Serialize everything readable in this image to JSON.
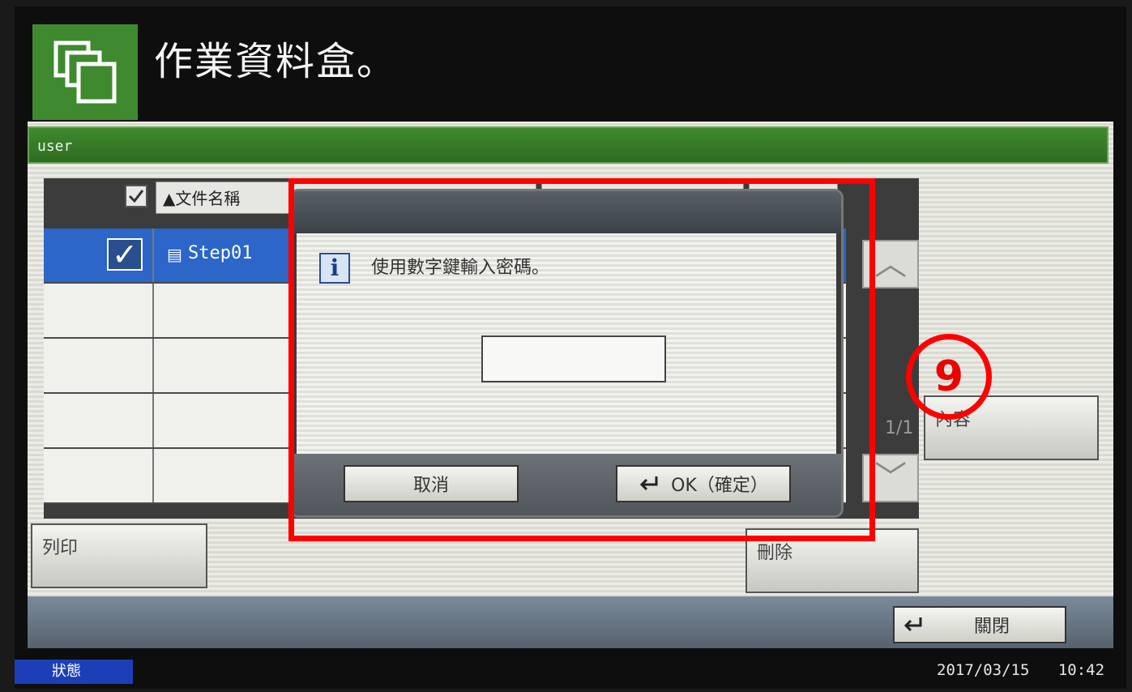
{
  "header": {
    "title": "作業資料盒。",
    "icon": "folder-box-icon"
  },
  "box": {
    "user_label": "user"
  },
  "list": {
    "column_name": "▲文件名稱",
    "rows": [
      {
        "name": "Step01",
        "selected": true
      },
      {
        "name": "",
        "selected": false
      },
      {
        "name": "",
        "selected": false
      },
      {
        "name": "",
        "selected": false
      },
      {
        "name": "",
        "selected": false
      }
    ],
    "page_indicator": "1/1"
  },
  "buttons": {
    "print": "列印",
    "delete": "刪除",
    "details": "內容",
    "close": "關閉"
  },
  "dialog": {
    "message": "使用數字鍵輸入密碼。",
    "password_value": "",
    "cancel": "取消",
    "ok": "OK（確定）"
  },
  "annotation": {
    "step_number": "9",
    "color": "#ff0000"
  },
  "footer": {
    "status_tab": "狀態",
    "date": "2017/03/15",
    "time": "10:42"
  }
}
